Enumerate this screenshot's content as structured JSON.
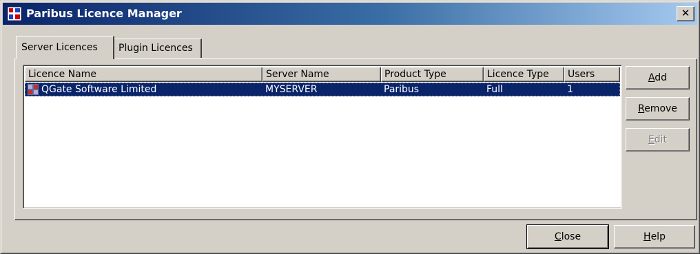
{
  "window": {
    "title": "Paribus Licence Manager",
    "close_glyph": "✕"
  },
  "tabs": [
    {
      "label": "Server Licences",
      "active": true
    },
    {
      "label": "Plugin Licences",
      "active": false
    }
  ],
  "table": {
    "columns": [
      "Licence Name",
      "Server Name",
      "Product Type",
      "Licence Type",
      "Users"
    ],
    "rows": [
      {
        "licence_name": "QGate Software Limited",
        "server_name": "MYSERVER",
        "product_type": "Paribus",
        "licence_type": "Full",
        "users": "1",
        "selected": true
      }
    ]
  },
  "side_buttons": {
    "add": {
      "accel": "A",
      "rest": "dd",
      "enabled": true
    },
    "remove": {
      "accel": "R",
      "rest": "emove",
      "enabled": true
    },
    "edit": {
      "accel": "E",
      "rest": "dit",
      "enabled": false
    }
  },
  "bottom_buttons": {
    "close": {
      "accel": "C",
      "rest": "lose"
    },
    "help": {
      "accel": "H",
      "rest": "elp"
    }
  },
  "colors": {
    "selection": "#0a246a",
    "face": "#d4d0c8"
  }
}
